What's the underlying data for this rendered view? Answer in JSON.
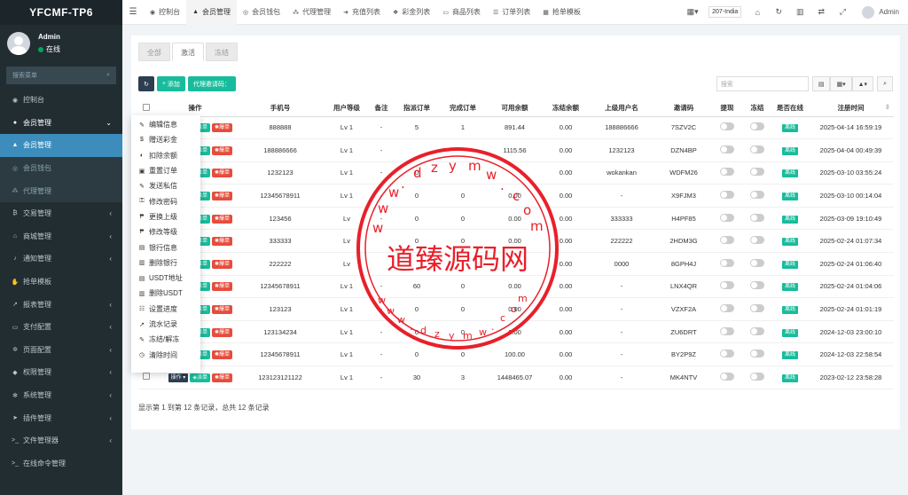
{
  "brand": "YFCMF-TP6",
  "user": {
    "name": "Admin",
    "status": "在线"
  },
  "sidebar": {
    "search_placeholder": "搜索菜单",
    "items": [
      {
        "label": "控制台",
        "icon": "dashboard-icon",
        "glyph": "◉",
        "chev": ""
      },
      {
        "label": "会员管理",
        "icon": "users-icon",
        "glyph": "●",
        "chev": "⌄"
      },
      {
        "label": "会员管理",
        "icon": "user-icon",
        "glyph": "▲",
        "chev": ""
      },
      {
        "label": "会员钱包",
        "icon": "wallet-icon",
        "glyph": "◎",
        "chev": ""
      },
      {
        "label": "代理管理",
        "icon": "sitemap-icon",
        "glyph": "⁂",
        "chev": ""
      },
      {
        "label": "交易管理",
        "icon": "bitcoin-icon",
        "glyph": "₿",
        "chev": "‹"
      },
      {
        "label": "商城管理",
        "icon": "home-icon",
        "glyph": "⌂",
        "chev": "‹"
      },
      {
        "label": "通知管理",
        "icon": "bell-icon",
        "glyph": "♪",
        "chev": "‹"
      },
      {
        "label": "抢单模板",
        "icon": "hand-icon",
        "glyph": "✋",
        "chev": ""
      },
      {
        "label": "报表管理",
        "icon": "chart-icon",
        "glyph": "↗",
        "chev": "‹"
      },
      {
        "label": "支付配置",
        "icon": "card-icon",
        "glyph": "▭",
        "chev": "‹"
      },
      {
        "label": "页面配置",
        "icon": "gear-icon",
        "glyph": "✲",
        "chev": "‹"
      },
      {
        "label": "权限管理",
        "icon": "group-icon",
        "glyph": "◆",
        "chev": "‹"
      },
      {
        "label": "系统管理",
        "icon": "cogs-icon",
        "glyph": "✻",
        "chev": "‹"
      },
      {
        "label": "插件管理",
        "icon": "rocket-icon",
        "glyph": "➤",
        "chev": "‹"
      },
      {
        "label": "文件管理器",
        "icon": "terminal-icon",
        "glyph": ">_",
        "chev": "‹"
      },
      {
        "label": "在线命令管理",
        "icon": "terminal-icon",
        "glyph": ">_",
        "chev": ""
      }
    ]
  },
  "topbar": {
    "tabs": [
      {
        "label": "控制台",
        "icon": "dashboard-icon",
        "glyph": "◉"
      },
      {
        "label": "会员管理",
        "icon": "user-icon",
        "glyph": "▲"
      },
      {
        "label": "会员钱包",
        "icon": "wallet-icon",
        "glyph": "◎"
      },
      {
        "label": "代理管理",
        "icon": "sitemap-icon",
        "glyph": "⁂"
      },
      {
        "label": "充值列表",
        "icon": "arrow-icon",
        "glyph": "➜"
      },
      {
        "label": "彩金列表",
        "icon": "gift-icon",
        "glyph": "❖"
      },
      {
        "label": "商品列表",
        "icon": "desktop-icon",
        "glyph": "▭"
      },
      {
        "label": "订单列表",
        "icon": "list-icon",
        "glyph": "☰"
      },
      {
        "label": "抢单模板",
        "icon": "grid-icon",
        "glyph": "▦"
      }
    ],
    "lang": "207-India",
    "admin": "Admin"
  },
  "tabs": [
    "全部",
    "激活",
    "冻结"
  ],
  "toolbar": {
    "add": "添加",
    "invite": "代理邀请码：",
    "search_placeholder": "搜索"
  },
  "table": {
    "headers": [
      "",
      "操作",
      "手机号",
      "用户等级",
      "备注",
      "指派订单",
      "完成订单",
      "可用余额",
      "冻结余额",
      "上级用户名",
      "邀请码",
      "提现",
      "冻结",
      "是否在线",
      "注册时间"
    ],
    "btn_dispatch": "派单",
    "btn_blast": "爆单",
    "btn_op": "操作",
    "online_label": "离线",
    "rows": [
      [
        "888888",
        "Lv 1",
        "-",
        "5",
        "1",
        "891.44",
        "0.00",
        "188886666",
        "7SZV2C",
        "2025-04-14 16:59:19"
      ],
      [
        "188886666",
        "Lv 1",
        "-",
        "",
        "",
        "1115.56",
        "0.00",
        "1232123",
        "DZN4BP",
        "2025-04-04 00:49:39"
      ],
      [
        "1232123",
        "Lv 1",
        "-",
        "0",
        "",
        "",
        "0.00",
        "wokankan",
        "WDFM26",
        "2025-03-10 03:55:24"
      ],
      [
        "12345678911",
        "Lv 1",
        "-",
        "0",
        "0",
        "0.00",
        "0.00",
        "-",
        "X9FJM3",
        "2025-03-10 00:14:04"
      ],
      [
        "123456",
        "Lv",
        "-",
        "0",
        "0",
        "0.00",
        "0.00",
        "333333",
        "H4PF85",
        "2025-03-09 19:10:49"
      ],
      [
        "333333",
        "Lv",
        "",
        "0",
        "0",
        "0.00",
        "0.00",
        "222222",
        "2HDM3G",
        "2025-02-24 01:07:34"
      ],
      [
        "222222",
        "Lv",
        "",
        "",
        "",
        "",
        "0.00",
        "0000",
        "8GPH4J",
        "2025-02-24 01:06:40"
      ],
      [
        "12345678911",
        "Lv 1",
        "-",
        "60",
        "0",
        "0.00",
        "0.00",
        "-",
        "LNX4QR",
        "2025-02-24 01:04:06"
      ],
      [
        "123123",
        "Lv 1",
        "-",
        "0",
        "0",
        "0.00",
        "0.00",
        "-",
        "VZXF2A",
        "2025-02-24 01:01:19"
      ],
      [
        "123134234",
        "Lv 1",
        "-",
        "0",
        "0",
        "0.00",
        "0.00",
        "-",
        "ZU6DRT",
        "2024-12-03 23:00:10"
      ],
      [
        "12345678911",
        "Lv 1",
        "-",
        "0",
        "0",
        "100.00",
        "0.00",
        "-",
        "BY2P9Z",
        "2024-12-03 22:58:54"
      ],
      [
        "123123121122",
        "Lv 1",
        "-",
        "30",
        "3",
        "1448465.07",
        "0.00",
        "-",
        "MK4NTV",
        "2023-02-12 23:58:28"
      ]
    ]
  },
  "footer": "显示第 1 到第 12 条记录，总共 12 条记录",
  "dropdown": [
    {
      "label": "编辑信息",
      "icon": "pencil-icon",
      "glyph": "✎"
    },
    {
      "label": "赠送彩金",
      "icon": "dollar-icon",
      "glyph": "$"
    },
    {
      "label": "扣除余额",
      "icon": "minus-icon",
      "glyph": "◐"
    },
    {
      "label": "重置订单",
      "icon": "calendar-icon",
      "glyph": "▣"
    },
    {
      "label": "发送私信",
      "icon": "pencil-icon",
      "glyph": "✎"
    },
    {
      "label": "修改密码",
      "icon": "lock-icon",
      "glyph": "⚿"
    },
    {
      "label": "更换上级",
      "icon": "rupee-icon",
      "glyph": "₱"
    },
    {
      "label": "修改等级",
      "icon": "rupee-icon",
      "glyph": "₱"
    },
    {
      "label": "银行信息",
      "icon": "bank-icon",
      "glyph": "▤"
    },
    {
      "label": "删除银行",
      "icon": "trash-icon",
      "glyph": "▥"
    },
    {
      "label": "USDT地址",
      "icon": "bank-icon",
      "glyph": "▤"
    },
    {
      "label": "删除USDT",
      "icon": "trash-icon",
      "glyph": "▥"
    },
    {
      "label": "设置进度",
      "icon": "sliders-icon",
      "glyph": "☷"
    },
    {
      "label": "流水记录",
      "icon": "chart-icon",
      "glyph": "↗"
    },
    {
      "label": "冻结/解冻",
      "icon": "pencil-icon",
      "glyph": "✎"
    },
    {
      "label": "清除时间",
      "icon": "clock-icon",
      "glyph": "◷"
    }
  ],
  "stamp": {
    "text": "道臻源码网",
    "url": "www.dzym.com"
  }
}
